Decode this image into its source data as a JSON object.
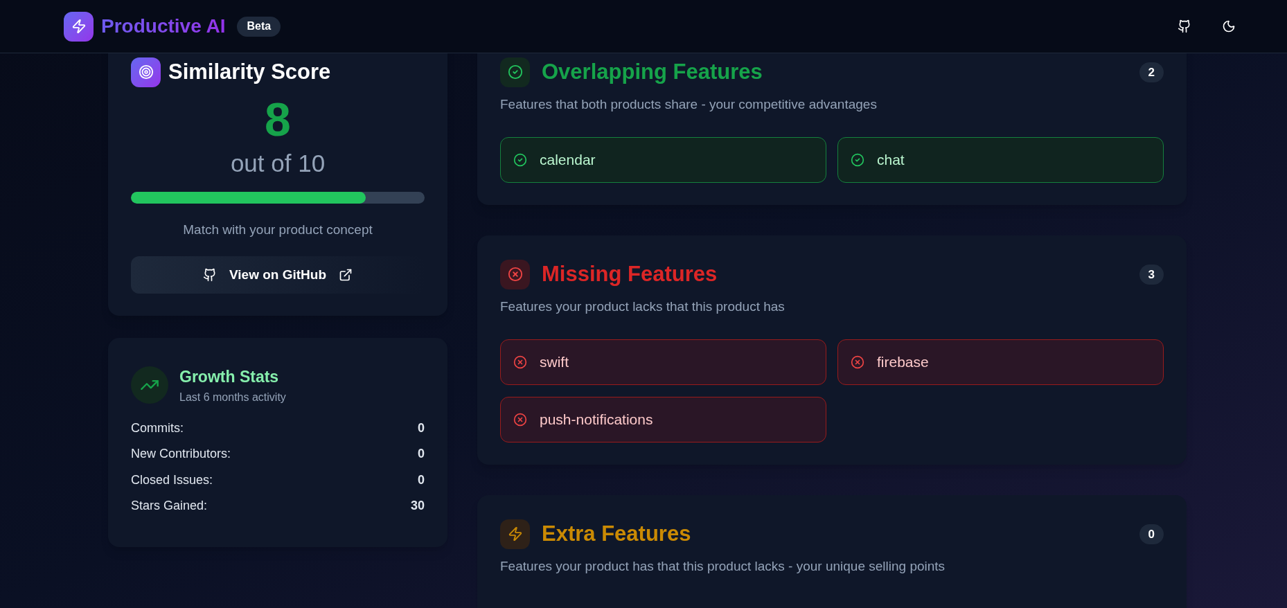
{
  "header": {
    "brand": "Productive AI",
    "badge": "Beta"
  },
  "similarity": {
    "title": "Similarity Score",
    "score": "8",
    "out_of": "out of 10",
    "level": 0.8,
    "caption": "Match with your product concept",
    "button": "View on GitHub"
  },
  "growth": {
    "title": "Growth Stats",
    "subtitle": "Last 6 months activity",
    "stats": [
      {
        "label": "Commits:",
        "value": "0"
      },
      {
        "label": "New Contributors:",
        "value": "0"
      },
      {
        "label": "Closed Issues:",
        "value": "0"
      },
      {
        "label": "Stars Gained:",
        "value": "30"
      }
    ]
  },
  "sections": [
    {
      "kind": "overlapping",
      "title": "Overlapping Features",
      "description": "Features that both products share - your competitive advantages",
      "count": "2",
      "features": [
        "calendar",
        "chat"
      ]
    },
    {
      "kind": "missing",
      "title": "Missing Features",
      "description": "Features your product lacks that this product has",
      "count": "3",
      "features": [
        "swift",
        "firebase",
        "push-notifications"
      ]
    },
    {
      "kind": "extra",
      "title": "Extra Features",
      "description": "Features your product has that this product lacks - your unique selling points",
      "count": "0"
    }
  ]
}
